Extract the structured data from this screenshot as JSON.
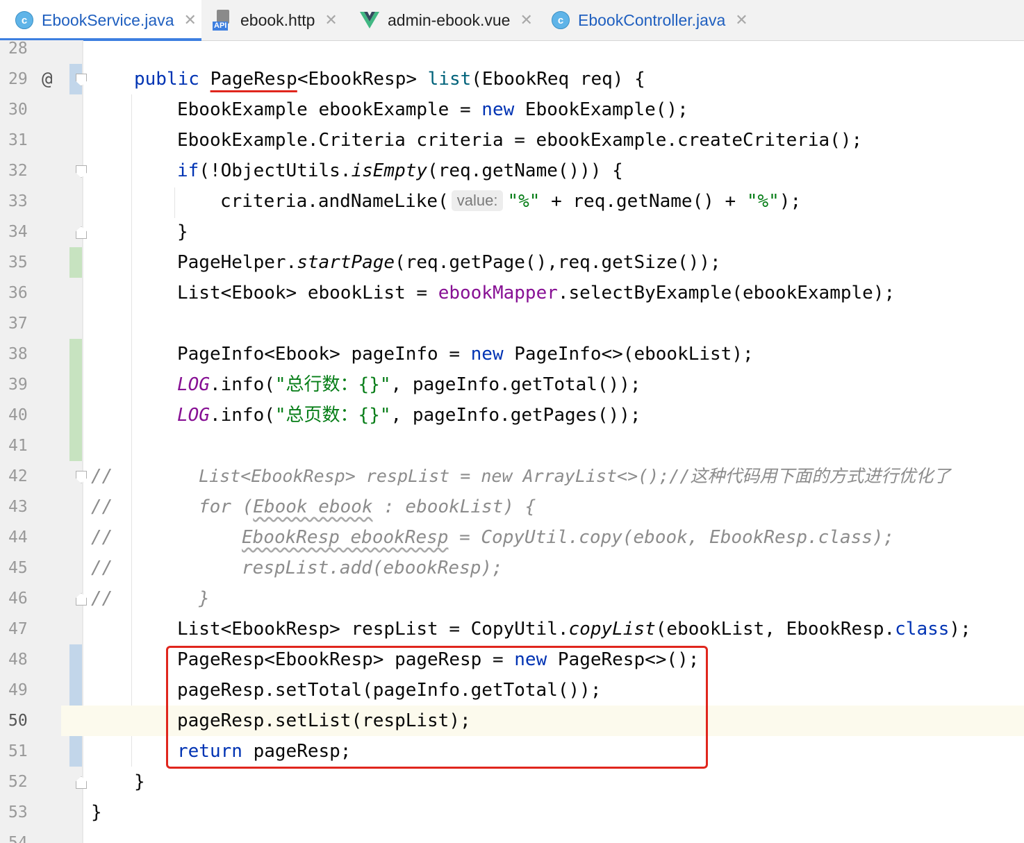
{
  "tabs": [
    {
      "label": "EbookService.java",
      "icon": "java-class-icon",
      "active": true
    },
    {
      "label": "ebook.http",
      "icon": "api-http-icon",
      "active": false
    },
    {
      "label": "admin-ebook.vue",
      "icon": "vue-icon",
      "active": false
    },
    {
      "label": "EbookController.java",
      "icon": "java-class-icon",
      "active": false
    }
  ],
  "tab_close_glyph": "✕",
  "class_icon_letter": "c",
  "api_icon_text": "API",
  "current_line": 50,
  "line_numbers": [
    "28",
    "29",
    "30",
    "31",
    "32",
    "33",
    "34",
    "35",
    "36",
    "37",
    "38",
    "39",
    "40",
    "41",
    "42",
    "43",
    "44",
    "45",
    "46",
    "47",
    "48",
    "49",
    "50",
    "51",
    "52",
    "53",
    "54"
  ],
  "gutter": {
    "override_marker": "@"
  },
  "code": {
    "l29": {
      "public": "public",
      "ret": "PageResp",
      "ret_rest": "<EbookResp> ",
      "method": "list",
      "params": "(EbookReq req) {"
    },
    "l30": {
      "a": "EbookExample ebookExample = ",
      "new": "new",
      "b": " EbookExample();"
    },
    "l31": {
      "a": "EbookExample.Criteria criteria = ebookExample.createCriteria();"
    },
    "l32": {
      "if": "if",
      "a": "(!ObjectUtils.",
      "m": "isEmpty",
      "b": "(req.getName())) {"
    },
    "l33": {
      "a": "criteria.andNameLike(",
      "hint": "value:",
      "s1": "\"%\"",
      "b": " + req.getName() + ",
      "s2": "\"%\"",
      "c": ");"
    },
    "l34": {
      "a": "}"
    },
    "l35": {
      "a": "PageHelper.",
      "m": "startPage",
      "b": "(req.getPage(),req.getSize());"
    },
    "l36": {
      "a": "List<Ebook> ebookList = ",
      "f": "ebookMapper",
      "b": ".selectByExample(ebookExample);"
    },
    "l38": {
      "a": "PageInfo<Ebook> pageInfo = ",
      "new": "new",
      "b": " PageInfo<>(ebookList);"
    },
    "l39": {
      "log": "LOG",
      "a": ".info(",
      "s": "\"总行数：{}\"",
      "b": ", pageInfo.getTotal());"
    },
    "l40": {
      "log": "LOG",
      "a": ".info(",
      "s": "\"总页数：{}\"",
      "b": ", pageInfo.getPages());"
    },
    "l42": {
      "slash": "//",
      "a": "List<EbookResp> respList = new ArrayList<>();//这种代码用下面的方式进行优化了"
    },
    "l43": {
      "slash": "//",
      "a": "for (",
      "w": "Ebook ebook",
      "b": " : ebookList) {"
    },
    "l44": {
      "slash": "//",
      "w": "EbookResp ebookResp",
      "b": " = CopyUtil.copy(ebook, EbookResp.class);"
    },
    "l45": {
      "slash": "//",
      "a": "respList.add(ebookResp);"
    },
    "l46": {
      "slash": "//",
      "a": "}"
    },
    "l47": {
      "a": "List<EbookResp> respList = CopyUtil.",
      "m": "copyList",
      "b": "(ebookList, EbookResp.",
      "kw": "class",
      "c": ");"
    },
    "l48": {
      "a": "PageResp<EbookResp> pageResp = ",
      "new": "new",
      "b": " PageResp<>();"
    },
    "l49": {
      "a": "pageResp.setTotal(pageInfo.getTotal());"
    },
    "l50": {
      "a": "pageResp.setList(respList);"
    },
    "l51": {
      "ret": "return",
      "a": " pageResp;"
    },
    "l52": {
      "a": "}"
    },
    "l53": {
      "a": "}"
    }
  },
  "colors": {
    "keyword": "#0033b3",
    "string": "#067d17",
    "field": "#871094",
    "comment": "#8c8c8c",
    "highlight": "#e0261d",
    "accent": "#3d7fe0"
  }
}
